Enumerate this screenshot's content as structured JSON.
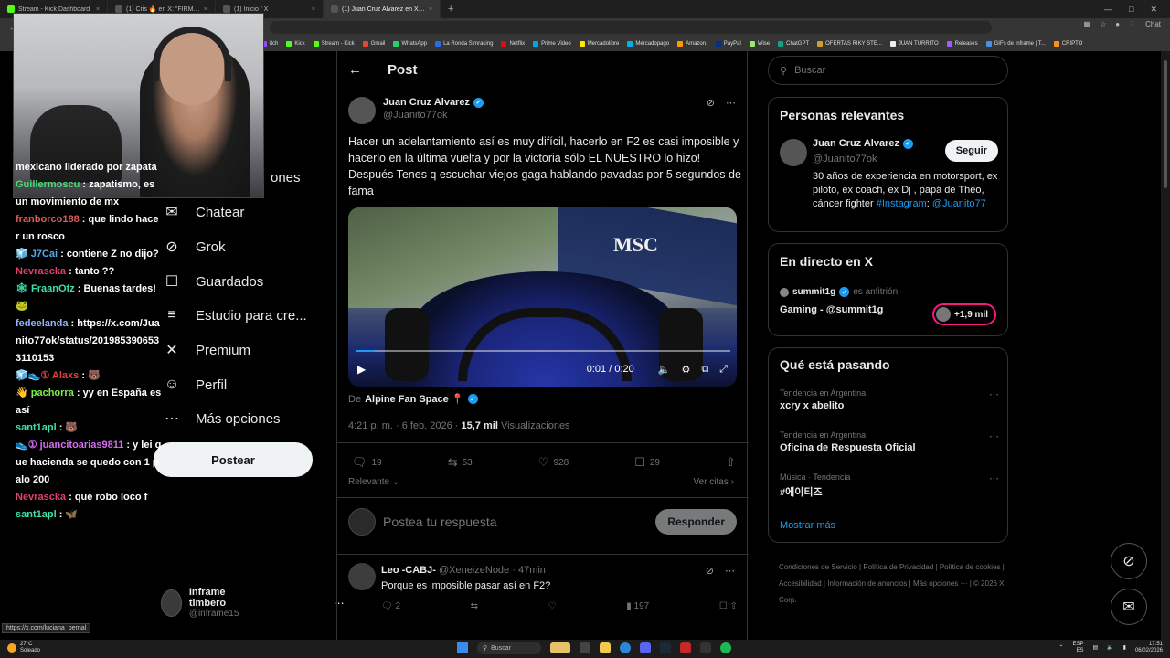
{
  "browser": {
    "tabs": [
      {
        "label": "Stream - Kick Dashboard",
        "color": "#53fc18",
        "active": false
      },
      {
        "label": "(1) Cris 🔥 en X: \"FIRMAN QUE SI",
        "color": "#555555",
        "active": false
      },
      {
        "label": "(1) Inicio / X",
        "color": "#555555",
        "active": false
      },
      {
        "label": "(1) Juan Cruz Alvarez en X: \"Hacer",
        "color": "#555555",
        "active": true
      }
    ],
    "new_tab": "+",
    "bookmarks": [
      {
        "label": "itch",
        "color": "#9146ff"
      },
      {
        "label": "Kick",
        "color": "#53fc18"
      },
      {
        "label": "Stream - Kick",
        "color": "#53fc18"
      },
      {
        "label": "Gmail",
        "color": "#ea4335"
      },
      {
        "label": "WhatsApp",
        "color": "#25d366"
      },
      {
        "label": "La Ronda Simracing",
        "color": "#2b6be4"
      },
      {
        "label": "Netflix",
        "color": "#e50914"
      },
      {
        "label": "Prime Video",
        "color": "#00a8e1"
      },
      {
        "label": "Mercadolibre",
        "color": "#ffe600"
      },
      {
        "label": "Mercadopago",
        "color": "#00b1ea"
      },
      {
        "label": "Amazon.",
        "color": "#ff9900"
      },
      {
        "label": "PayPal",
        "color": "#003087"
      },
      {
        "label": "Wise",
        "color": "#9fe870"
      },
      {
        "label": "ChatGPT",
        "color": "#10a37f"
      },
      {
        "label": "OFERTAS RIKY STE...",
        "color": "#c9a227"
      },
      {
        "label": "JUAN TURRITO",
        "color": "#eeeeee"
      },
      {
        "label": "Releases",
        "color": "#a259ff"
      },
      {
        "label": "GIFs de Inframe | T...",
        "color": "#4a90e2"
      },
      {
        "label": "CRIPTO",
        "color": "#f7931a"
      }
    ],
    "chat_label": "Chat",
    "status_url": "https://x.com/luciana_bernal"
  },
  "nav": {
    "partial_label": "ones",
    "items": [
      {
        "label": "Chatear",
        "icon": "mail-icon"
      },
      {
        "label": "Grok",
        "icon": "grok-icon"
      },
      {
        "label": "Guardados",
        "icon": "bookmark-icon"
      },
      {
        "label": "Estudio para cre...",
        "icon": "studio-icon"
      },
      {
        "label": "Premium",
        "icon": "x-logo-icon"
      },
      {
        "label": "Perfil",
        "icon": "person-icon"
      },
      {
        "label": "Más opciones",
        "icon": "more-circle-icon"
      }
    ],
    "post_button": "Postear",
    "account": {
      "name": "Inframe timbero",
      "handle": "@inframe15",
      "more": "⋯"
    }
  },
  "post": {
    "header": "Post",
    "author": {
      "name": "Juan Cruz Alvarez",
      "handle": "@Juanito77ok"
    },
    "text": "Hacer un adelantamiento así es muy difícil, hacerlo en F2 es casi imposible y hacerlo en la última vuelta y por la victoria sólo EL NUESTRO lo hizo! Después Tenes q escuchar viejos gaga hablando pavadas por 5 segundos de fama",
    "video": {
      "time": "0:01 / 0:20",
      "progress": 0.05,
      "sign": "MSC"
    },
    "source_prefix": "De",
    "source_name": "Alpine Fan Space 📍",
    "timestamp": "4:21 p. m. · 6 feb. 2026 · ",
    "views": "15,7 mil",
    "views_label": "Visualizaciones",
    "stats": {
      "replies": "19",
      "reposts": "53",
      "likes": "928",
      "bookmarks": "29"
    },
    "relevance": "Relevante",
    "quotes": "Ver citas",
    "reply_placeholder": "Postea tu respuesta",
    "reply_button": "Responder"
  },
  "comment": {
    "name": "Leo -CABJ-",
    "handle": "@XeneizeNode",
    "time": "· 47min",
    "text": "Porque es imposible pasar así en F2?",
    "replies": "2",
    "views": "197"
  },
  "sidebar": {
    "search_placeholder": "Buscar",
    "relevant_title": "Personas relevantes",
    "person": {
      "name": "Juan Cruz Alvarez",
      "handle": "@Juanito77ok",
      "bio": "30 años de experiencia en motorsport, ex piloto, ex coach, ex Dj , papá de Theo, cáncer fighter",
      "bio_hashtag": "#Instagram",
      "bio_sep": ":",
      "bio_link": "@Juanito77",
      "follow": "Seguir"
    },
    "live_title": "En directo en X",
    "live": {
      "host": "summit1g",
      "host_suffix": "es anfitrión",
      "title": "Gaming - @summit1g",
      "listeners": "+1,9 mil"
    },
    "trends_title": "Qué está pasando",
    "trends": [
      {
        "category": "Tendencia en Argentina",
        "name": "xcry x abelito"
      },
      {
        "category": "Tendencia en Argentina",
        "name": "Oficina de Respuesta Oficial"
      },
      {
        "category": "Música · Tendencia",
        "name": "#에이티즈"
      }
    ],
    "show_more": "Mostrar más",
    "footer": [
      "Condiciones de Servicio",
      "Política de Privacidad",
      "Política de cookies",
      "Accesibilidad",
      "Información de anuncios",
      "Más opciones ···",
      "© 2026 X Corp."
    ]
  },
  "stream_chat": [
    {
      "user": "",
      "color": "#ffffff",
      "text": "mexicano liderado por zapata"
    },
    {
      "user": "Guillermoscu",
      "color": "#4ed87a",
      "text": " : zapatismo, es un movimiento de mx"
    },
    {
      "user": "franborco188",
      "color": "#e05a5a",
      "text": " : que lindo hacer un rosco"
    },
    {
      "user": "🧊 J7Cai",
      "color": "#5aa9e6",
      "text": " : contiene Z no dijo?"
    },
    {
      "user": "Nevrascka",
      "color": "#e0406a",
      "text": " : tanto ??"
    },
    {
      "user": "🕸 FraanOtz",
      "color": "#3fe0a8",
      "text": " : Buenas tardes! 🐸"
    },
    {
      "user": "fedeelanda",
      "color": "#8fb8ff",
      "text": " : https://x.com/Juanito77ok/status/2019853906533110153"
    },
    {
      "user": "🧊👟① Alaxs",
      "color": "#e04040",
      "text": " : 🐻"
    },
    {
      "user": "👋 pachorra",
      "color": "#7cf04a",
      "text": " : yy en España es así"
    },
    {
      "user": "sant1apl",
      "color": "#3fe0a8",
      "text": " : 🐻"
    },
    {
      "user": "👟① juancitoarias9811",
      "color": "#d46cf0",
      "text": " : y lei que hacienda se quedo con 1 palo 200"
    },
    {
      "user": "Nevrascka",
      "color": "#e0406a",
      "text": " : que robo loco f"
    },
    {
      "user": "sant1apl",
      "color": "#3fe0a8",
      "text": " : 🦋"
    }
  ],
  "taskbar": {
    "temp": "27°C",
    "weather": "Soleado",
    "search": "Buscar",
    "lang": "ESP",
    "lang_sub": "ES",
    "time": "17:51",
    "date": "06/02/2026"
  }
}
